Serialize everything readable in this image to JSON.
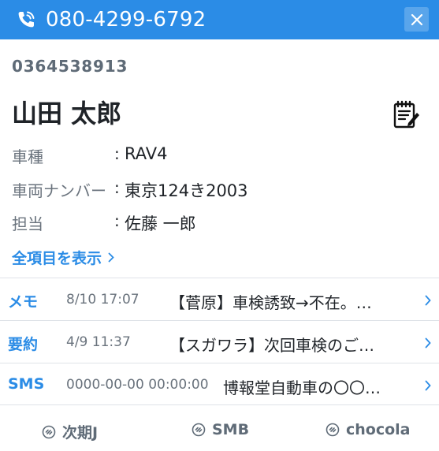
{
  "header": {
    "phone_number": "080-4299-6792",
    "phone_icon": "phone-call-icon",
    "close_icon": "close-icon"
  },
  "customer": {
    "code": "0364538913",
    "name": "山田 太郎",
    "memo_icon": "notepad-edit-icon",
    "fields": [
      {
        "label": "車種",
        "sep": ":",
        "value": "RAV4"
      },
      {
        "label": "車両ナンバー",
        "sep": ":",
        "value": "東京124き2003"
      },
      {
        "label": "担当",
        "sep": ":",
        "value": "佐藤 一郎"
      }
    ],
    "show_all": "全項目を表示"
  },
  "records": [
    {
      "type": "メモ",
      "date": "8/10 17:07",
      "text": "【菅原】車検誘致→不在。…"
    },
    {
      "type": "要約",
      "date": "4/9 11:37",
      "text": "【スガワラ】次回車検のご…"
    },
    {
      "type": "SMS",
      "date": "0000-00-00 00:00:00",
      "text": "博報堂自動車の〇〇…"
    }
  ],
  "footer": {
    "links": [
      {
        "label": "次期J",
        "icon": "link-icon"
      },
      {
        "label": "SMB",
        "icon": "link-icon"
      },
      {
        "label": "chocola",
        "icon": "link-icon"
      }
    ]
  },
  "colors": {
    "accent": "#2b8ce6",
    "muted": "#6a737d",
    "text": "#1f2328",
    "divider": "#dfe3e8"
  }
}
